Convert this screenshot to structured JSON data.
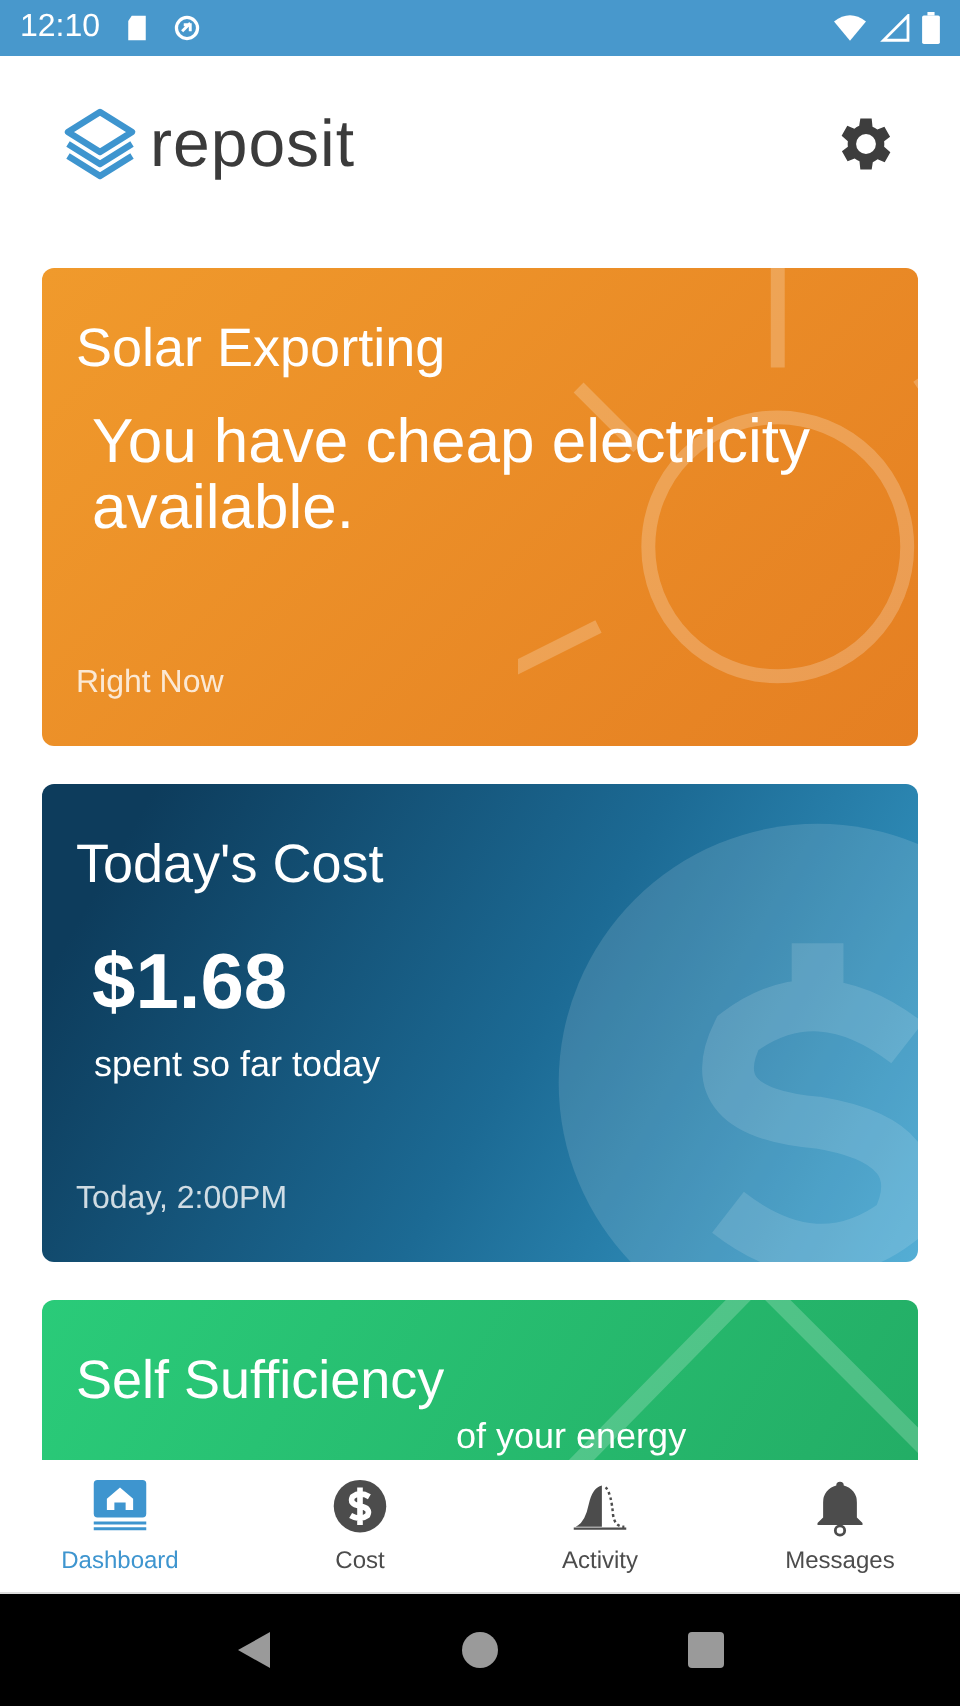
{
  "status_bar": {
    "time": "12:10"
  },
  "header": {
    "logo_text": "reposit"
  },
  "cards": [
    {
      "kind": "solar",
      "title": "Solar Exporting",
      "message": "You have cheap electricity available.",
      "footer": "Right Now"
    },
    {
      "kind": "cost",
      "title": "Today's Cost",
      "value": "$1.68",
      "caption": "spent so far today",
      "footer": "Today, 2:00PM"
    },
    {
      "kind": "sufficiency",
      "title": "Self Sufficiency",
      "caption": "of your energy"
    }
  ],
  "nav": [
    {
      "label": "Dashboard",
      "selected": true
    },
    {
      "label": "Cost",
      "selected": false
    },
    {
      "label": "Activity",
      "selected": false
    },
    {
      "label": "Messages",
      "selected": false
    }
  ]
}
